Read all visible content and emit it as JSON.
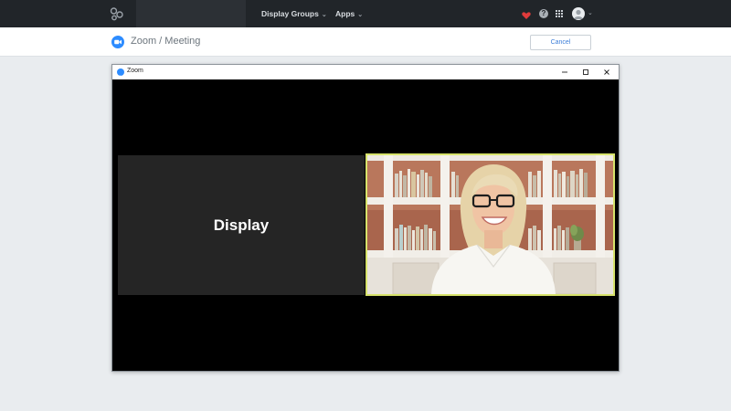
{
  "nav": {
    "logo_icon": "app-logo-icon",
    "items": [
      {
        "label": "Display Groups"
      },
      {
        "label": "Apps"
      }
    ],
    "icons": [
      "heart-icon",
      "help-icon",
      "apps-grid-icon",
      "user-avatar"
    ]
  },
  "header": {
    "title": "Zoom / Meeting",
    "cancel_label": "Cancel"
  },
  "window": {
    "title": "Zoom",
    "display_label": "Display"
  },
  "colors": {
    "zoom_blue": "#2d8cff",
    "heart_red": "#e03b3b",
    "active_speaker": "#d7e36b"
  }
}
